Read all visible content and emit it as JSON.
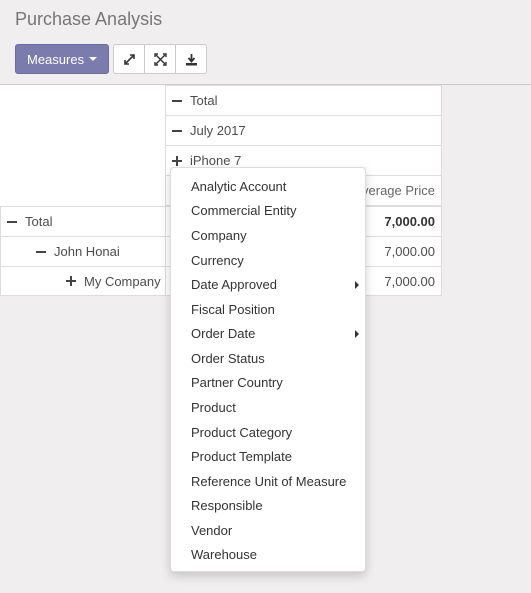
{
  "page": {
    "title": "Purchase Analysis"
  },
  "toolbar": {
    "measures_label": "Measures",
    "buttons": [
      {
        "icon": "expand-icon"
      },
      {
        "icon": "fullscreen-icon"
      },
      {
        "icon": "download-icon"
      }
    ]
  },
  "pivot": {
    "col_headers": [
      "Total",
      "July 2017",
      "iPhone 7"
    ],
    "measure_header": "Average Price",
    "rows": [
      {
        "label": "Total",
        "value": "7,000.00"
      },
      {
        "label": "John Honai",
        "value": "7,000.00"
      },
      {
        "label": "My Company",
        "value": "7,000.00"
      }
    ]
  },
  "groupby_menu": {
    "items": [
      "Analytic Account",
      "Commercial Entity",
      "Company",
      "Currency",
      "Date Approved",
      "Fiscal Position",
      "Order Date",
      "Order Status",
      "Partner Country",
      "Product",
      "Product Category",
      "Product Template",
      "Reference Unit of Measure",
      "Responsible",
      "Vendor",
      "Warehouse"
    ]
  },
  "colors": {
    "primary": "#7c7bad",
    "background": "#f0eeee"
  }
}
